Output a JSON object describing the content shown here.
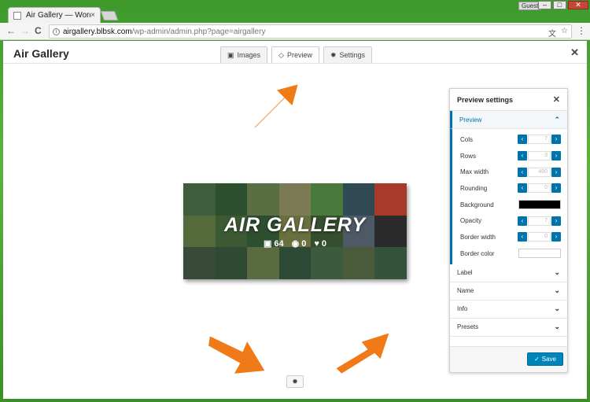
{
  "browser": {
    "tab_title": "Air Gallery — WordPress",
    "tab_close": "×",
    "profile_label": "Guest",
    "url_host": "airgallery.blbsk.com",
    "url_path": "/wp-admin/admin.php?page=airgallery",
    "back_glyph": "←",
    "forward_glyph": "→",
    "reload_glyph": "C",
    "menu_glyph": "⋮",
    "translate_glyph": "文",
    "star_glyph": "☆",
    "min_glyph": "–",
    "max_glyph": "□",
    "close_glyph": "✕"
  },
  "app": {
    "title": "Air Gallery",
    "close_glyph": "✕",
    "tabs": [
      {
        "label": "Images",
        "icon": "image-icon",
        "glyph": "▣"
      },
      {
        "label": "Preview",
        "icon": "diamond-icon",
        "glyph": "◇"
      },
      {
        "label": "Settings",
        "icon": "gear-icon",
        "glyph": "✹"
      }
    ],
    "active_tab": "Preview"
  },
  "preview": {
    "title": "AIR GALLERY",
    "images_count": "64",
    "views_count": "0",
    "likes_count": "0",
    "images_glyph": "▣",
    "views_glyph": "◉",
    "likes_glyph": "♥",
    "tile_colors": [
      "#3d5e3a",
      "#2c4f2e",
      "#5a6e44",
      "#7b7a55",
      "#4a7a3b",
      "#2f4a55",
      "#a83a2a",
      "#556b3c",
      "#3b5a34",
      "#2e4e30",
      "#6a6f40",
      "#354e2f",
      "#4d5a66",
      "#2b2b2b",
      "#3a4a3a",
      "#2f4a33",
      "#5a6b42",
      "#2d4a36",
      "#3c5a3c",
      "#4b5a3a",
      "#35533a"
    ]
  },
  "panel": {
    "title": "Preview settings",
    "close_glyph": "✕",
    "active_section": {
      "label": "Preview",
      "chevron": "⌃"
    },
    "props": [
      {
        "label": "Cols",
        "value": "7"
      },
      {
        "label": "Rows",
        "value": "3"
      },
      {
        "label": "Max width",
        "value": "480"
      },
      {
        "label": "Rounding",
        "value": "0"
      },
      {
        "label": "Opacity",
        "value": "7"
      },
      {
        "label": "Border width",
        "value": "0"
      }
    ],
    "background_label": "Background",
    "background_color": "#000000",
    "border_color_label": "Border color",
    "border_color": "#ffffff",
    "stepper_prev": "‹",
    "stepper_next": "›",
    "sections": [
      {
        "label": "Label",
        "chevron": "⌄"
      },
      {
        "label": "Name",
        "chevron": "⌄"
      },
      {
        "label": "Info",
        "chevron": "⌄"
      },
      {
        "label": "Presets",
        "chevron": "⌄"
      }
    ],
    "save_label": "Save",
    "save_glyph": "✓"
  },
  "bottom": {
    "gear_glyph": "✹"
  },
  "colors": {
    "accent": "#0073aa",
    "arrow": "#f07a18",
    "save": "#0085ba"
  }
}
